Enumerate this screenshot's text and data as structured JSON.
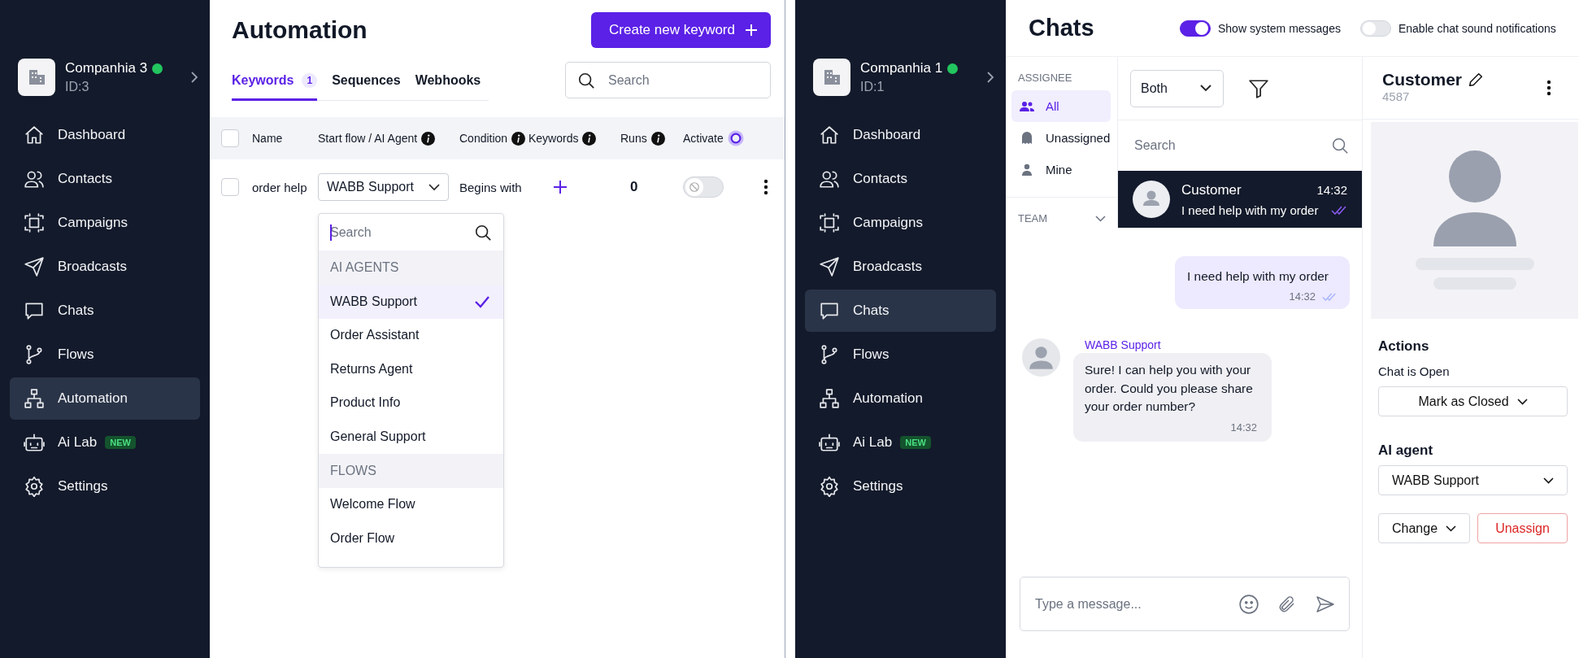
{
  "screens": [
    {
      "kind": "automation",
      "sidebar": {
        "company": {
          "name": "Companhia 3",
          "id": "ID:3",
          "online": true
        },
        "items": [
          {
            "label": "Dashboard",
            "selected": false
          },
          {
            "label": "Contacts",
            "selected": false
          },
          {
            "label": "Campaigns",
            "selected": false
          },
          {
            "label": "Broadcasts",
            "selected": false
          },
          {
            "label": "Chats",
            "selected": false
          },
          {
            "label": "Flows",
            "selected": false
          },
          {
            "label": "Automation",
            "selected": true
          },
          {
            "label": "Ai Lab",
            "badge": "NEW",
            "selected": false
          },
          {
            "label": "Settings",
            "selected": false
          }
        ]
      },
      "title": "Automation",
      "create_button": "Create new keyword",
      "tabs": [
        {
          "label": "Keywords",
          "count": "1",
          "selected": true
        },
        {
          "label": "Sequences",
          "selected": false
        },
        {
          "label": "Webhooks",
          "selected": false
        }
      ],
      "search": {
        "placeholder": "Search"
      },
      "table": {
        "select_all": {
          "checked": false
        },
        "columns": [
          {
            "label": "Name",
            "info": false
          },
          {
            "label": "Start flow / AI Agent",
            "info": true
          },
          {
            "label": "Condition",
            "info": true
          },
          {
            "label": "Keywords",
            "info": true
          },
          {
            "label": "Runs",
            "info": true
          },
          {
            "label": "Activate",
            "info": false
          }
        ],
        "rows": [
          {
            "checked": false,
            "name": "order help",
            "flow": "WABB Support",
            "condition": "Begins with",
            "runs": "0",
            "active": false
          }
        ]
      },
      "dropdown": {
        "search": {
          "placeholder": "Search"
        },
        "groups": [
          {
            "heading": "AI AGENTS",
            "options": [
              {
                "label": "WABB Support",
                "selected": true
              },
              {
                "label": "Order Assistant",
                "selected": false
              },
              {
                "label": "Returns Agent",
                "selected": false
              },
              {
                "label": "Product Info",
                "selected": false
              },
              {
                "label": "General Support",
                "selected": false
              }
            ]
          },
          {
            "heading": "FLOWS",
            "options": [
              {
                "label": "Welcome Flow",
                "selected": false
              },
              {
                "label": "Order Flow",
                "selected": false
              }
            ]
          }
        ]
      }
    },
    {
      "kind": "chats",
      "sidebar": {
        "company": {
          "name": "Companhia 1",
          "id": "ID:1",
          "online": true
        },
        "items": [
          {
            "label": "Dashboard",
            "selected": false
          },
          {
            "label": "Contacts",
            "selected": false
          },
          {
            "label": "Campaigns",
            "selected": false
          },
          {
            "label": "Broadcasts",
            "selected": false
          },
          {
            "label": "Chats",
            "selected": true
          },
          {
            "label": "Flows",
            "selected": false
          },
          {
            "label": "Automation",
            "selected": false
          },
          {
            "label": "Ai Lab",
            "badge": "NEW",
            "selected": false
          },
          {
            "label": "Settings",
            "selected": false
          }
        ]
      },
      "title": "Chats",
      "toggles": [
        {
          "label": "Show system messages",
          "on": true
        },
        {
          "label": "Enable chat sound notifications",
          "on": false
        }
      ],
      "assignee": {
        "heading": "ASSIGNEE",
        "items": [
          {
            "label": "All",
            "selected": true
          },
          {
            "label": "Unassigned",
            "selected": false
          },
          {
            "label": "Mine",
            "selected": false
          }
        ],
        "team": {
          "heading": "TEAM",
          "expanded": false
        }
      },
      "filter": {
        "value": "Both"
      },
      "search": {
        "placeholder": "Search"
      },
      "conversations": [
        {
          "name": "Customer",
          "time": "14:32",
          "preview": "I need help with my order",
          "selected": true
        }
      ],
      "messages": [
        {
          "kind": "outgoing",
          "text": "I need help with my order",
          "time": "14:32"
        },
        {
          "kind": "incoming",
          "sender": "WABB Support",
          "text": "Sure! I can help you with your order. Could you please share your order number?",
          "time": "14:32"
        }
      ],
      "composer": {
        "placeholder": "Type a message..."
      },
      "contact": {
        "name": "Customer",
        "id": "4587",
        "actions_heading": "Actions",
        "status": "Chat is Open",
        "mark_button": "Mark as Closed",
        "ai_heading": "AI agent",
        "ai_agent": "WABB Support",
        "change_button": "Change",
        "unassign_button": "Unassign"
      }
    }
  ]
}
